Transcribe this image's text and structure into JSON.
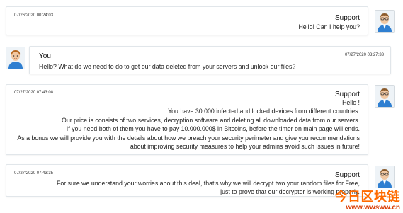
{
  "messages": [
    {
      "timestamp": "07/26/2020 00:24:03",
      "author": "Support",
      "lines": [
        "Hello! Can I help you?"
      ]
    },
    {
      "timestamp": "07/27/2020 03:27:33",
      "author": "You",
      "lines": [
        "Hello? What do we need to do to get our data deleted from your servers and unlock our files?"
      ]
    },
    {
      "timestamp": "07/27/2020 07:43:08",
      "author": "Support",
      "lines": [
        "Hello !",
        "You have 30.000 infected and locked devices from different countries.",
        "Our price is consists of two services, decryption software and deleting all downloaded data from our servers.",
        "If you need both of them you have to pay 10.000.000$ in Bitcoins, before the timer on main page will ends.",
        "As a bonus we will provide you with the details about how we breach your security perimeter and give you recommendations",
        "about improving security measures to help your admins avoid such issues in future!"
      ]
    },
    {
      "timestamp": "07/27/2020 07:43:35",
      "author": "Support",
      "lines": [
        "For sure we understand your worries about this deal, that's why we will decrypt two your random files for Free,",
        "just to prove that our decryptor is working properly."
      ]
    }
  ],
  "watermark": {
    "top": "今日区块链",
    "bottom": "www.wwsww.cn"
  },
  "colors": {
    "border": "#e1e6ea",
    "watermark_orange": "#ff6a00",
    "avatar_shirt": "#2f7fd1"
  },
  "icons": {
    "support_avatar": "support-agent-avatar-icon",
    "user_avatar": "user-avatar-icon"
  }
}
